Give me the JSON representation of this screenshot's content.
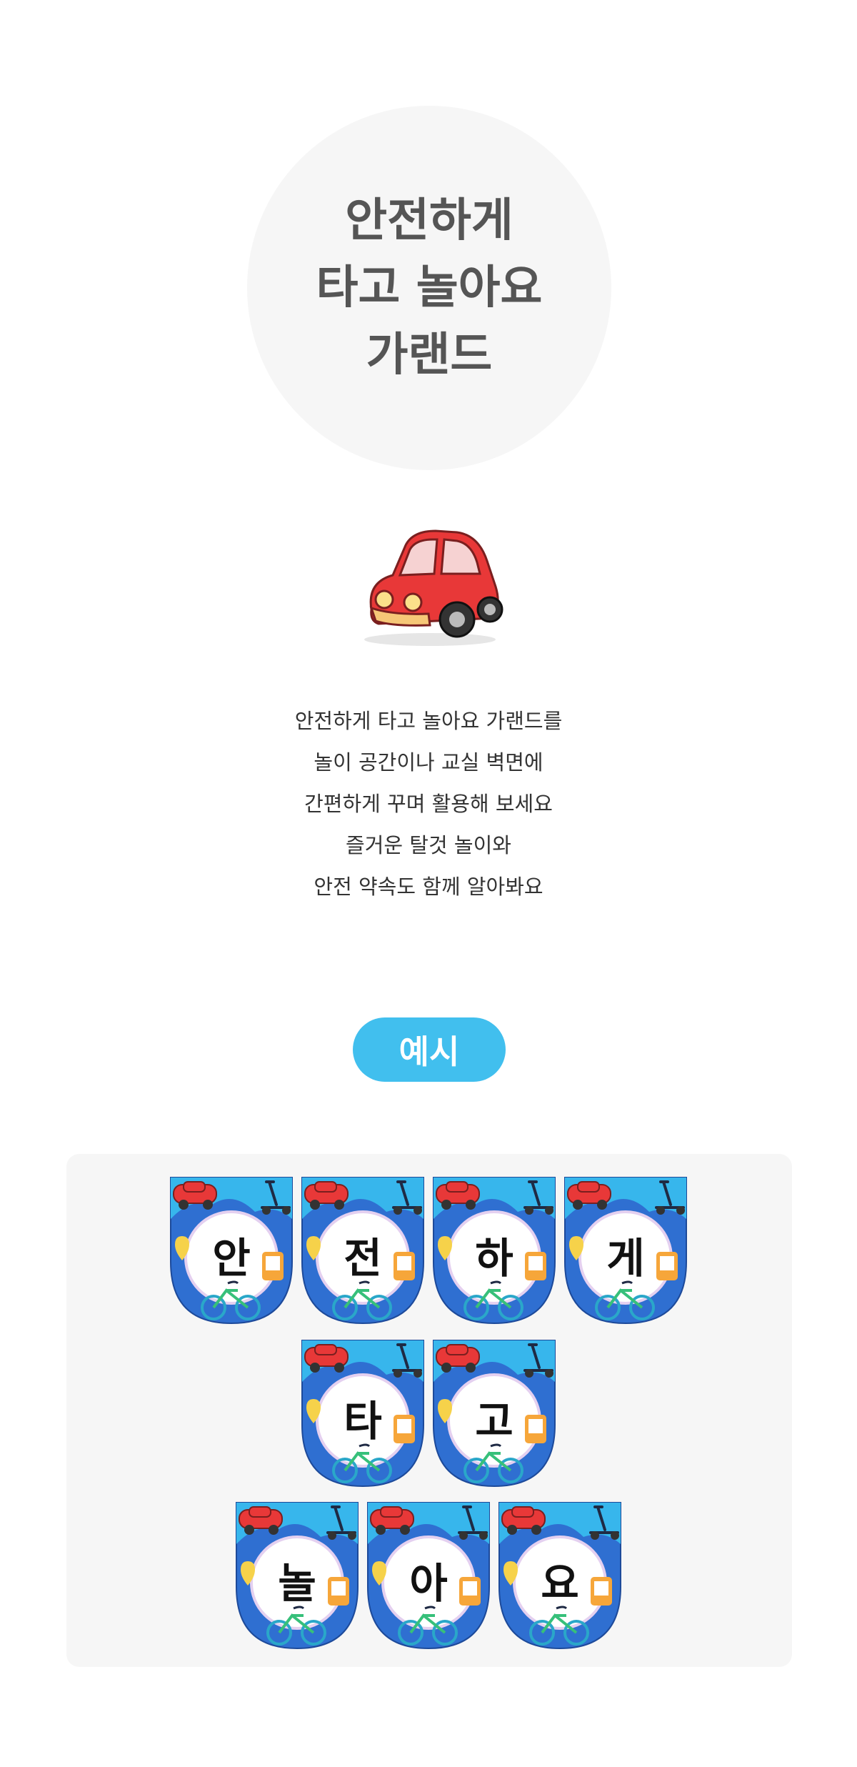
{
  "title": {
    "lines": [
      "안전하게",
      "타고 놀아요",
      "가랜드"
    ]
  },
  "illustration": {
    "icon": "red-car-icon"
  },
  "description": {
    "lines": [
      "안전하게 타고 놀아요 가랜드를",
      "놀이 공간이나 교실 벽면에",
      "간편하게 꾸며 활용해 보세요",
      "즐거운 탈것 놀이와",
      "안전 약속도 함께 알아봐요"
    ]
  },
  "example_label": "예시",
  "garland": {
    "rows": [
      [
        "안",
        "전",
        "하",
        "게"
      ],
      [
        "타",
        "고"
      ],
      [
        "놀",
        "아",
        "요"
      ]
    ]
  },
  "colors": {
    "title_circle": "#f6f6f6",
    "title_text": "#555555",
    "pill": "#41bfee",
    "flag_blue_dark": "#2f6fd1",
    "flag_blue_light": "#37b6ec",
    "car_red": "#e83838"
  }
}
